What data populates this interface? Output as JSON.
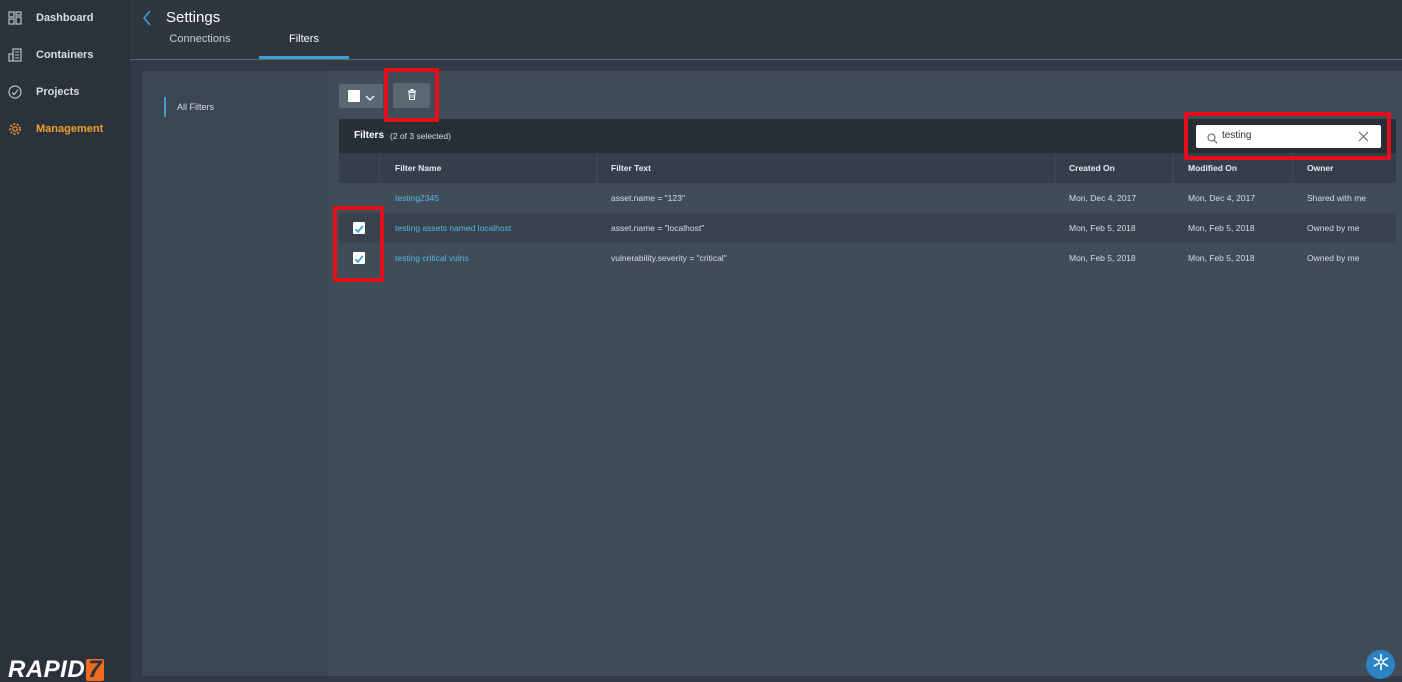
{
  "nav": {
    "items": [
      {
        "label": "Dashboard",
        "icon": "dashboard-icon"
      },
      {
        "label": "Containers",
        "icon": "containers-icon"
      },
      {
        "label": "Projects",
        "icon": "projects-icon"
      },
      {
        "label": "Management",
        "icon": "gear-icon",
        "active": true
      }
    ],
    "logo": {
      "text": "RAPID",
      "mark": "7"
    }
  },
  "header": {
    "title": "Settings",
    "tabs": [
      {
        "label": "Connections"
      },
      {
        "label": "Filters",
        "active": true
      }
    ]
  },
  "sidebar": {
    "item": "All Filters"
  },
  "table": {
    "title": "Filters",
    "selection_count": "(2 of 3 selected)",
    "search_value": "testing",
    "columns": [
      "Filter Name",
      "Filter Text",
      "Created On",
      "Modified On",
      "Owner"
    ],
    "rows": [
      {
        "name": "testing2345",
        "text": "asset.name = \"123\"",
        "created": "Mon, Dec 4, 2017",
        "modified": "Mon, Dec 4, 2017",
        "owner": "Shared with me",
        "checked": false
      },
      {
        "name": "testing assets named localhost",
        "text": "asset.name = \"localhost\"",
        "created": "Mon, Feb 5, 2018",
        "modified": "Mon, Feb 5, 2018",
        "owner": "Owned by me",
        "checked": true
      },
      {
        "name": "testing critical vulns",
        "text": "vulnerability.severity = \"critical\"",
        "created": "Mon, Feb 5, 2018",
        "modified": "Mon, Feb 5, 2018",
        "owner": "Owned by me",
        "checked": true
      }
    ]
  },
  "colors": {
    "accent": "#3d9fd3",
    "active_nav": "#f0a02b",
    "link": "#5ab7e6",
    "highlight": "#e3101b"
  }
}
